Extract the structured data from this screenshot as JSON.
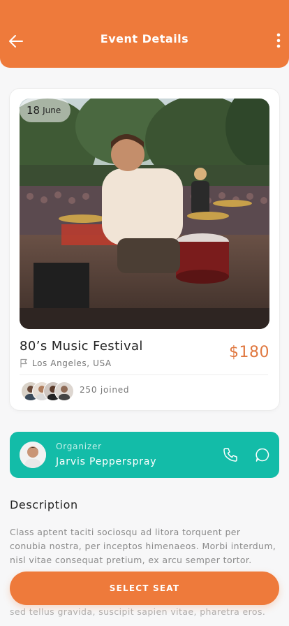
{
  "header": {
    "title": "Event Details",
    "background": "#ee7a3b",
    "back_icon": "arrow-left-icon",
    "menu_icon": "more-vertical-icon"
  },
  "event": {
    "date_day": "18",
    "date_month": "June",
    "title": "80’s Music Festival",
    "price": "$180",
    "location": "Los Angeles, USA",
    "location_icon": "flag-icon",
    "joined": "250 joined",
    "attendee_avatars": [
      "avatar-1",
      "avatar-2",
      "avatar-3",
      "avatar-4"
    ],
    "price_color": "#e07840"
  },
  "organizer": {
    "label": "Organizer",
    "name": "Jarvis Pepperspray",
    "background": "#13bca8",
    "call_icon": "phone-icon",
    "chat_icon": "chat-bubble-icon"
  },
  "description": {
    "heading": "Description",
    "text": "Class aptent taciti sociosqu ad litora torquent per conubia nostra, per inceptos himenaeos. Morbi interdum, nisl vitae consequat pretium, ex arcu semper tortor.",
    "text_continued": "sed tellus gravida, suscipit sapien vitae, pharetra eros."
  },
  "actions": {
    "select_seat": "SELECT SEAT"
  }
}
